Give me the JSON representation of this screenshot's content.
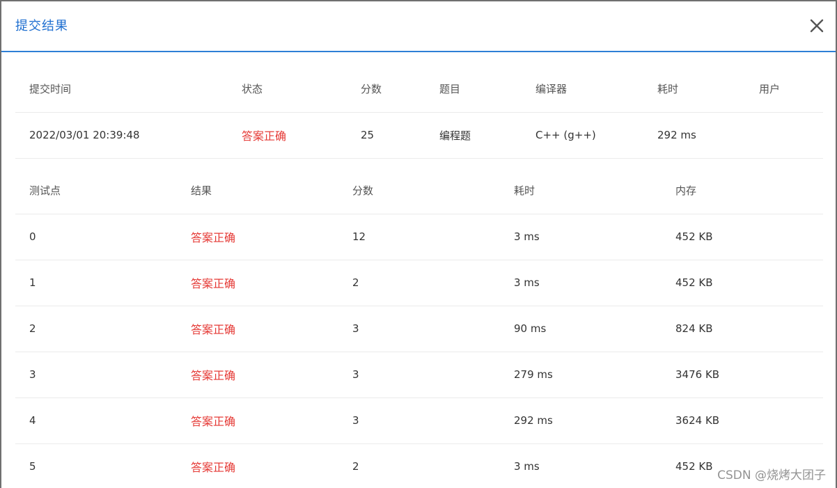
{
  "dialog": {
    "title": "提交结果",
    "close_icon": "close-icon"
  },
  "summary": {
    "headers": [
      "提交时间",
      "状态",
      "分数",
      "题目",
      "编译器",
      "耗时",
      "用户"
    ],
    "row": {
      "submit_time": "2022/03/01 20:39:48",
      "status": "答案正确",
      "score": "25",
      "problem": "编程题",
      "compiler": "C++ (g++)",
      "time": "292 ms",
      "user": ""
    }
  },
  "cases": {
    "headers": [
      "测试点",
      "结果",
      "分数",
      "耗时",
      "内存"
    ],
    "rows": [
      {
        "id": "0",
        "result": "答案正确",
        "score": "12",
        "time": "3 ms",
        "memory": "452 KB"
      },
      {
        "id": "1",
        "result": "答案正确",
        "score": "2",
        "time": "3 ms",
        "memory": "452 KB"
      },
      {
        "id": "2",
        "result": "答案正确",
        "score": "3",
        "time": "90 ms",
        "memory": "824 KB"
      },
      {
        "id": "3",
        "result": "答案正确",
        "score": "3",
        "time": "279 ms",
        "memory": "3476 KB"
      },
      {
        "id": "4",
        "result": "答案正确",
        "score": "3",
        "time": "292 ms",
        "memory": "3624 KB"
      },
      {
        "id": "5",
        "result": "答案正确",
        "score": "2",
        "time": "3 ms",
        "memory": "452 KB"
      }
    ]
  },
  "watermark": "CSDN @烧烤大团子",
  "colors": {
    "title": "#1f6fd0",
    "status_ok": "#e53935",
    "header_border": "#2d7fd6"
  }
}
